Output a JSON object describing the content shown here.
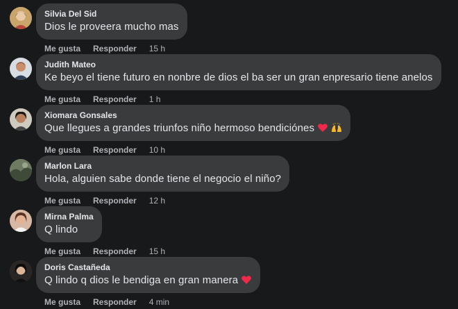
{
  "comments": [
    {
      "author": "Silvia Del Sid",
      "text": "Dios le proveera mucho mas",
      "like": "Me gusta",
      "reply": "Responder",
      "time": "15 h"
    },
    {
      "author": "Judith Mateo",
      "text": "Ke beyo el tiene futuro en nonbre de dios el ba ser un gran enpresario tiene anelos",
      "like": "Me gusta",
      "reply": "Responder",
      "time": "1 h"
    },
    {
      "author": "Xiomara Gonsales",
      "text": "Que llegues a grandes triunfos niño hermoso bendiciónes",
      "like": "Me gusta",
      "reply": "Responder",
      "time": "10 h",
      "emojis": [
        "red-heart-icon",
        "raising-hands-icon"
      ]
    },
    {
      "author": "Marlon Lara",
      "text": "Hola, alguien sabe donde tiene el negocio el niño?",
      "like": "Me gusta",
      "reply": "Responder",
      "time": "12 h"
    },
    {
      "author": "Mirna Palma",
      "text": "Q lindo",
      "like": "Me gusta",
      "reply": "Responder",
      "time": "15 h"
    },
    {
      "author": "Doris Castañeda",
      "text": "Q lindo q dios le bendiga en gran manera",
      "like": "Me gusta",
      "reply": "Responder",
      "time": "4 min",
      "emojis": [
        "red-heart-icon"
      ]
    }
  ],
  "colors": {
    "background": "#18191a",
    "bubble": "#3a3b3c",
    "primary_text": "#e4e6eb",
    "secondary_text": "#b0b3b8",
    "heart": "#f02849",
    "hands": "#f7b928"
  }
}
